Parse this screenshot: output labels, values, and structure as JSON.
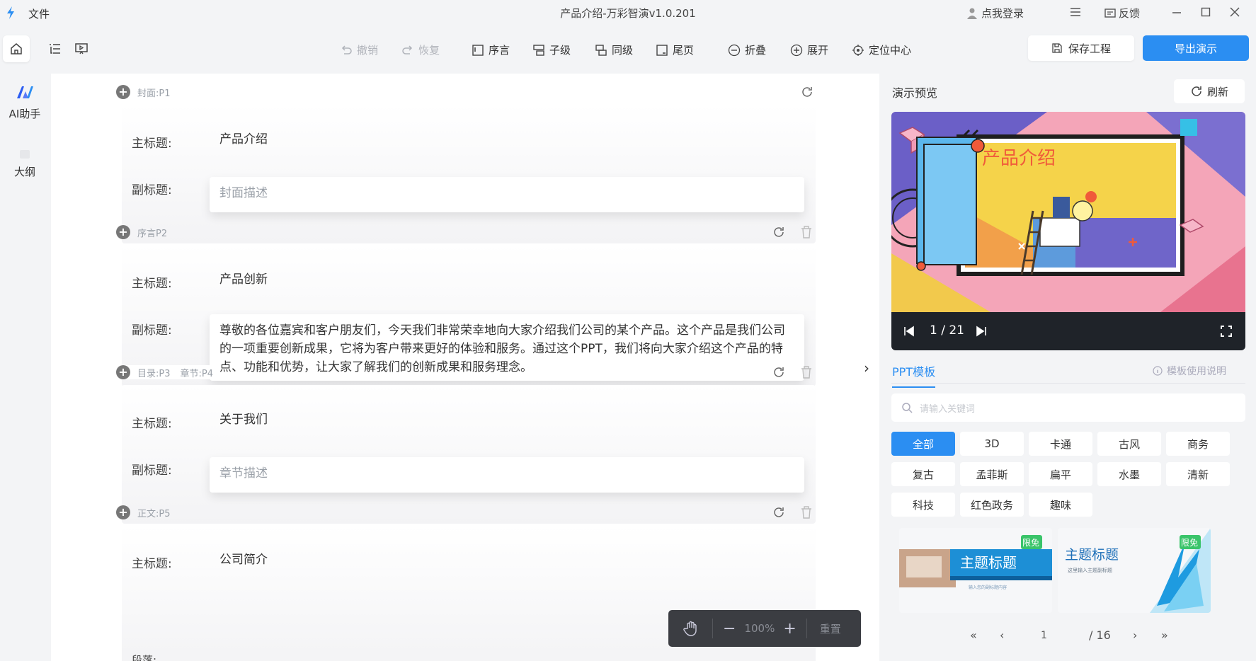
{
  "titlebar": {
    "file_menu": "文件",
    "title": "产品介绍-万彩智演v1.0.201",
    "login": "点我登录",
    "feedback": "反馈"
  },
  "toolbar": {
    "undo": "撤销",
    "redo": "恢复",
    "preface": "序言",
    "child": "子级",
    "sibling": "同级",
    "end_page": "尾页",
    "collapse": "折叠",
    "expand": "展开",
    "locate": "定位中心",
    "save": "保存工程",
    "export": "导出演示"
  },
  "sidebar": {
    "ai": "AI助手",
    "outline": "大纲"
  },
  "editor": {
    "sections": [
      {
        "head": "封面:P1",
        "main_label": "主标题:",
        "main_value": "产品介绍",
        "sub_label": "副标题:",
        "sub_placeholder": "封面描述"
      },
      {
        "head": "序言P2",
        "main_label": "主标题:",
        "main_value": "产品创新",
        "sub_label": "副标题:",
        "sub_value": "尊敬的各位嘉宾和客户朋友们，今天我们非常荣幸地向大家介绍我们公司的某个产品。这个产品是我们公司的一项重要创新成果，它将为客户带来更好的体验和服务。通过这个PPT，我们将向大家介绍这个产品的特点、功能和优势，让大家了解我们的创新成果和服务理念。"
      },
      {
        "head": "目录:P3",
        "head2": "章节:P4",
        "main_label": "主标题:",
        "main_value": "关于我们",
        "sub_label": "副标题:",
        "sub_placeholder": "章节描述"
      },
      {
        "head": "正文:P5",
        "main_label": "主标题:",
        "main_value": "公司简介",
        "para_label": "段落:"
      }
    ],
    "zoom": {
      "value": "100%",
      "reset": "重置"
    }
  },
  "preview": {
    "title": "演示预览",
    "refresh": "刷新",
    "slide_title": "产品介绍",
    "page_current": "1",
    "page_total": "21",
    "page_display": "1 / 21"
  },
  "templates": {
    "tab": "PPT模板",
    "help": "模板使用说明",
    "search_placeholder": "请输入关键词",
    "tags": [
      "全部",
      "3D",
      "卡通",
      "古风",
      "商务",
      "复古",
      "孟菲斯",
      "扁平",
      "水墨",
      "清新",
      "科技",
      "红色政务",
      "趣味"
    ],
    "thumb1_title": "主题标题",
    "thumb1_badge": "限免",
    "thumb1_caption": "输入您的副标题内容",
    "thumb2_title": "主题标题",
    "thumb2_badge": "限免",
    "thumb2_caption": "这里输入主题副标题",
    "pager": {
      "current": "1",
      "total": "/ 16"
    }
  },
  "colors": {
    "accent": "#2b8ef2",
    "player_bg": "#1f2329",
    "zoom_bg": "#3b3d42"
  }
}
